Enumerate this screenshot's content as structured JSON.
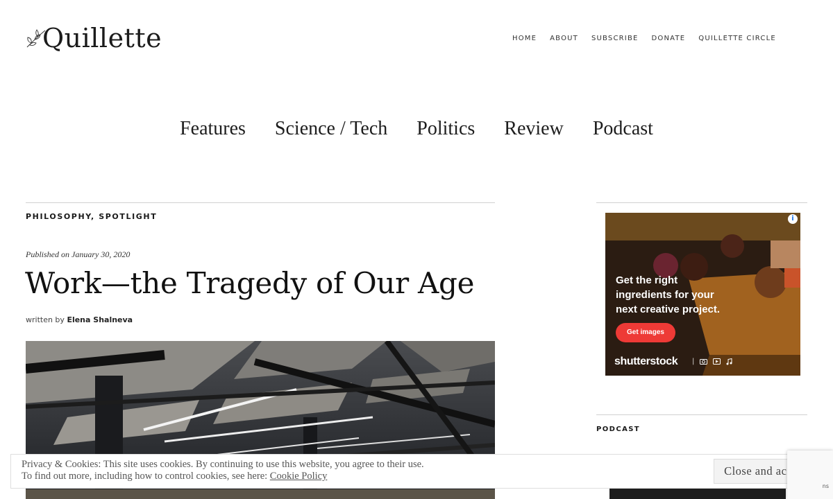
{
  "site": {
    "logo_text": "Quillette"
  },
  "top_nav": [
    "HOME",
    "ABOUT",
    "SUBSCRIBE",
    "DONATE",
    "QUILLETTE CIRCLE"
  ],
  "main_nav": [
    "Features",
    "Science / Tech",
    "Politics",
    "Review",
    "Podcast"
  ],
  "article": {
    "categories": [
      "PHILOSOPHY",
      "SPOTLIGHT"
    ],
    "category_separator": ", ",
    "published_prefix": "Published on",
    "published_date": "January 30, 2020",
    "title": "Work—the Tragedy of Our Age",
    "byline_prefix": "written by",
    "author": "Elena Shalneva"
  },
  "ad": {
    "info_icon": "info-icon",
    "headline": "Get the right ingredients for your next creative project.",
    "cta": "Get images",
    "brand": "shutterstock",
    "brand_icons": [
      "camera-icon",
      "video-icon",
      "music-note-icon"
    ]
  },
  "sidebar": {
    "podcast_label": "PODCAST"
  },
  "cookie_banner": {
    "line1": "Privacy & Cookies: This site uses cookies. By continuing to use this website, you agree to their use.",
    "line2_prefix": "To find out more, including how to control cookies, see here:",
    "link_text": "Cookie Policy",
    "button": "Close and accept"
  },
  "recaptcha": {
    "text": "ns"
  }
}
